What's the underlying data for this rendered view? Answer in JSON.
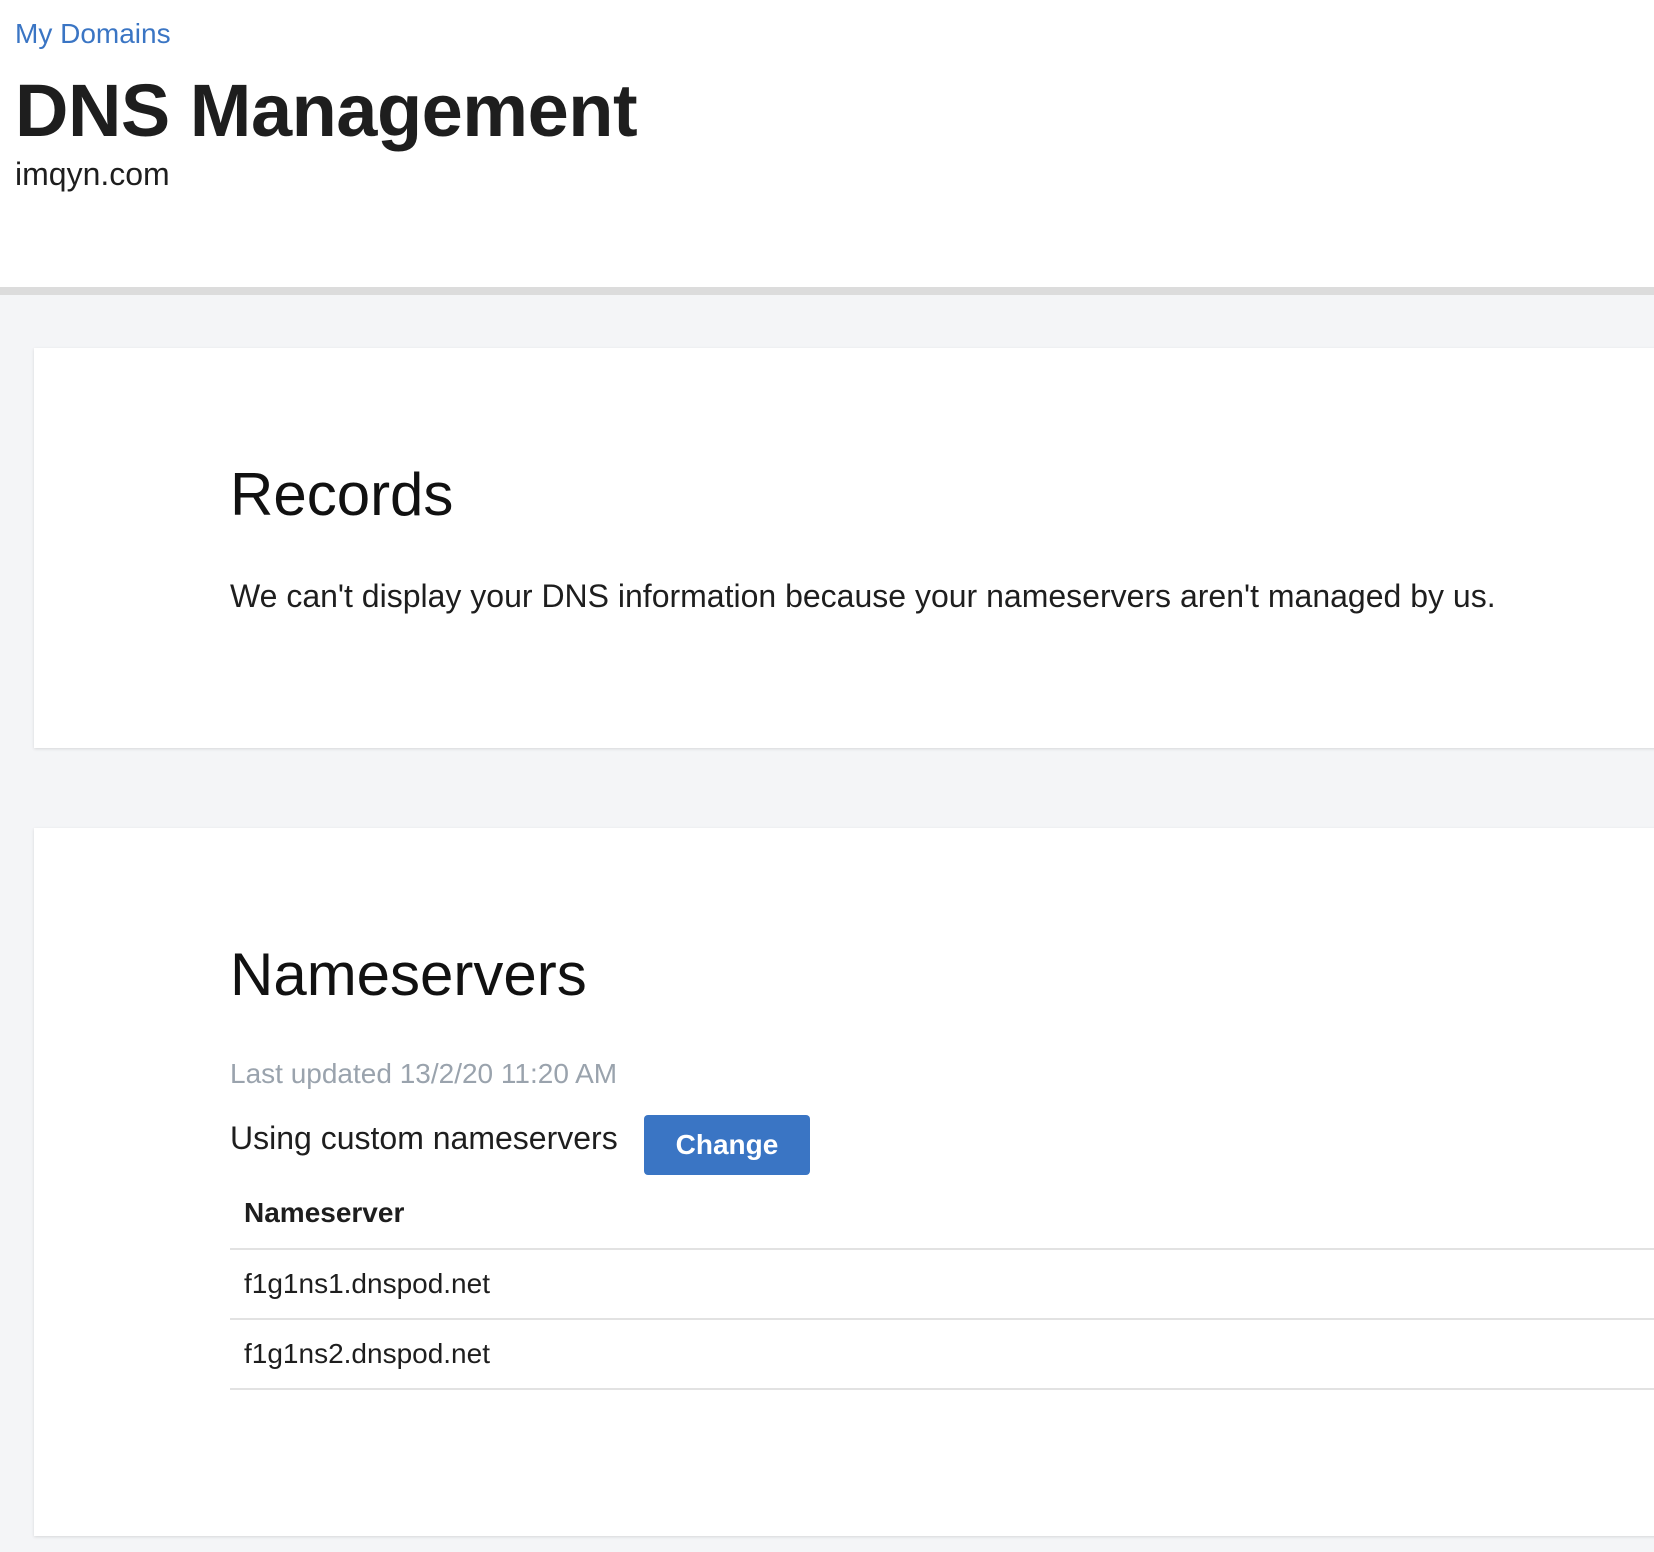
{
  "header": {
    "breadcrumb": "My Domains",
    "title": "DNS Management",
    "domain": "imqyn.com"
  },
  "records": {
    "title": "Records",
    "message": "We can't display your DNS information because your nameservers aren't managed by us."
  },
  "nameservers": {
    "title": "Nameservers",
    "last_updated": "Last updated 13/2/20 11:20 AM",
    "status": "Using custom nameservers",
    "change_label": "Change",
    "table": {
      "column_header": "Nameserver",
      "rows": [
        "f1g1ns1.dnspod.net",
        "f1g1ns2.dnspod.net"
      ]
    }
  },
  "colors": {
    "accent": "#3a75c4",
    "background": "#f4f5f7",
    "muted_text": "#9aa3ad"
  }
}
